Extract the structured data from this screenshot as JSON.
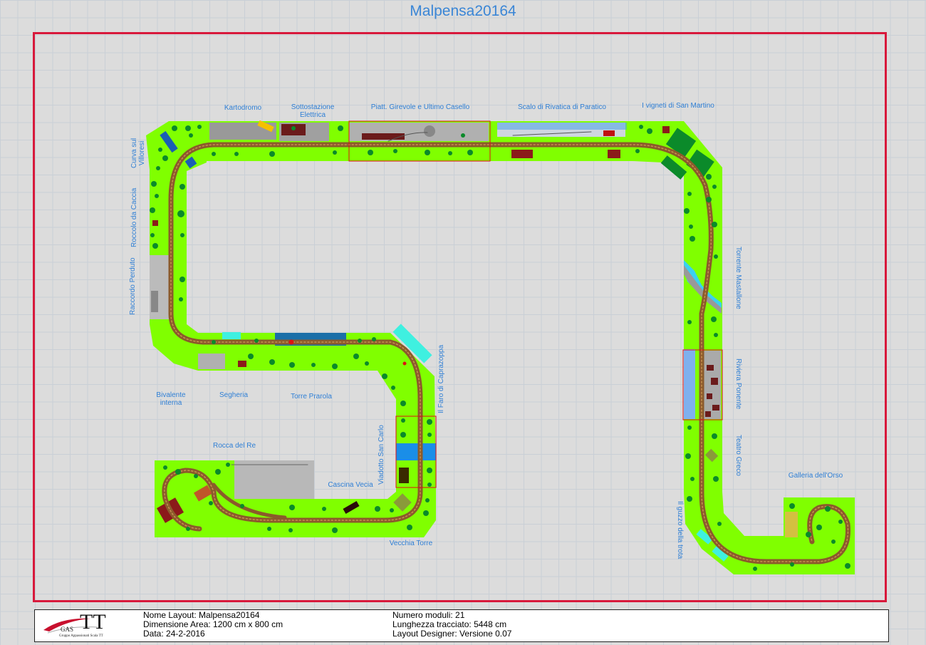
{
  "title": "Malpensa20164",
  "modules": [
    {
      "label": "Kartodromo"
    },
    {
      "label": "Sottostazione\nElettrica"
    },
    {
      "label": "Piatt. Girevole e Ultimo Casello"
    },
    {
      "label": "Scalo di Rivatica di Paratico"
    },
    {
      "label": "I vigneti di San Martino"
    },
    {
      "label": "Curva sul\nVilloresi"
    },
    {
      "label": "Roccolo da Caccia"
    },
    {
      "label": "Raccordo Perduto"
    },
    {
      "label": "Bivalente\ninterna"
    },
    {
      "label": "Segheria"
    },
    {
      "label": "Torre Prarola"
    },
    {
      "label": "Il Faro di Caprazoppa"
    },
    {
      "label": "Viadotto San Carlo"
    },
    {
      "label": "Rocca del Re"
    },
    {
      "label": "Cascina Vecia"
    },
    {
      "label": "Vecchia Torre"
    },
    {
      "label": "Torrente Mastallone"
    },
    {
      "label": "Riviera Ponente"
    },
    {
      "label": "Teatro Greco"
    },
    {
      "label": "Il guzzo della trota"
    },
    {
      "label": "Galleria dell'Orso"
    }
  ],
  "footer": {
    "logo_text": "TT",
    "logo_small": "GAS",
    "logo_sub": "Gruppo Appassionati Scala TT",
    "name_layout": "Nome Layout: Malpensa20164",
    "area": "Dimensione Area: 1200 cm x 800 cm",
    "date": "Data: 24-2-2016",
    "modules_count": "Numero moduli: 21",
    "track_length": "Lunghezza tracciato: 5448 cm",
    "designer": "Layout Designer: Versione 0.07"
  },
  "colors": {
    "module_green": "#80ff00",
    "track": "#8b5a2b",
    "tree": "#0a8a2a",
    "border_red": "#d8193b",
    "label_blue": "#2f7fd5",
    "water": "#1e8fe0"
  }
}
